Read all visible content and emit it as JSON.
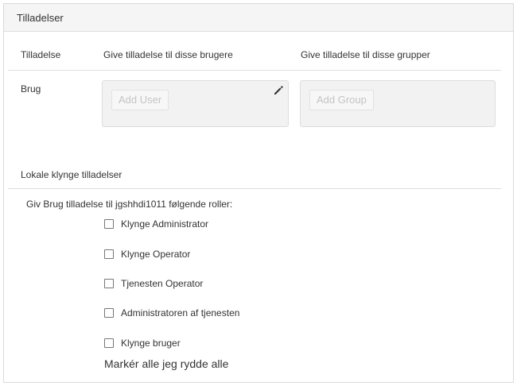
{
  "panel": {
    "title": "Tilladelser"
  },
  "permissions_table": {
    "col_permission": "Tilladelse",
    "col_users": "Give tilladelse til disse brugere",
    "col_groups": "Give tilladelse til disse grupper",
    "row_label": "Brug",
    "add_user_label": "Add User",
    "add_group_label": "Add Group",
    "edit_icon": "pencil-icon"
  },
  "local_cluster": {
    "section_label": "Lokale klynge tilladelser",
    "intro": "Giv Brug tilladelse til jgshhdi1011 følgende roller:",
    "roles": [
      {
        "label": "Klynge Administrator",
        "checked": false
      },
      {
        "label": "Klynge Operator",
        "checked": false
      },
      {
        "label": "Tjenesten Operator",
        "checked": false
      },
      {
        "label": "Administratoren af tjenesten",
        "checked": false
      },
      {
        "label": "Klynge bruger",
        "checked": false
      }
    ],
    "select_all_label": "Markér alle",
    "clear_all_label": "jeg rydde alle"
  }
}
